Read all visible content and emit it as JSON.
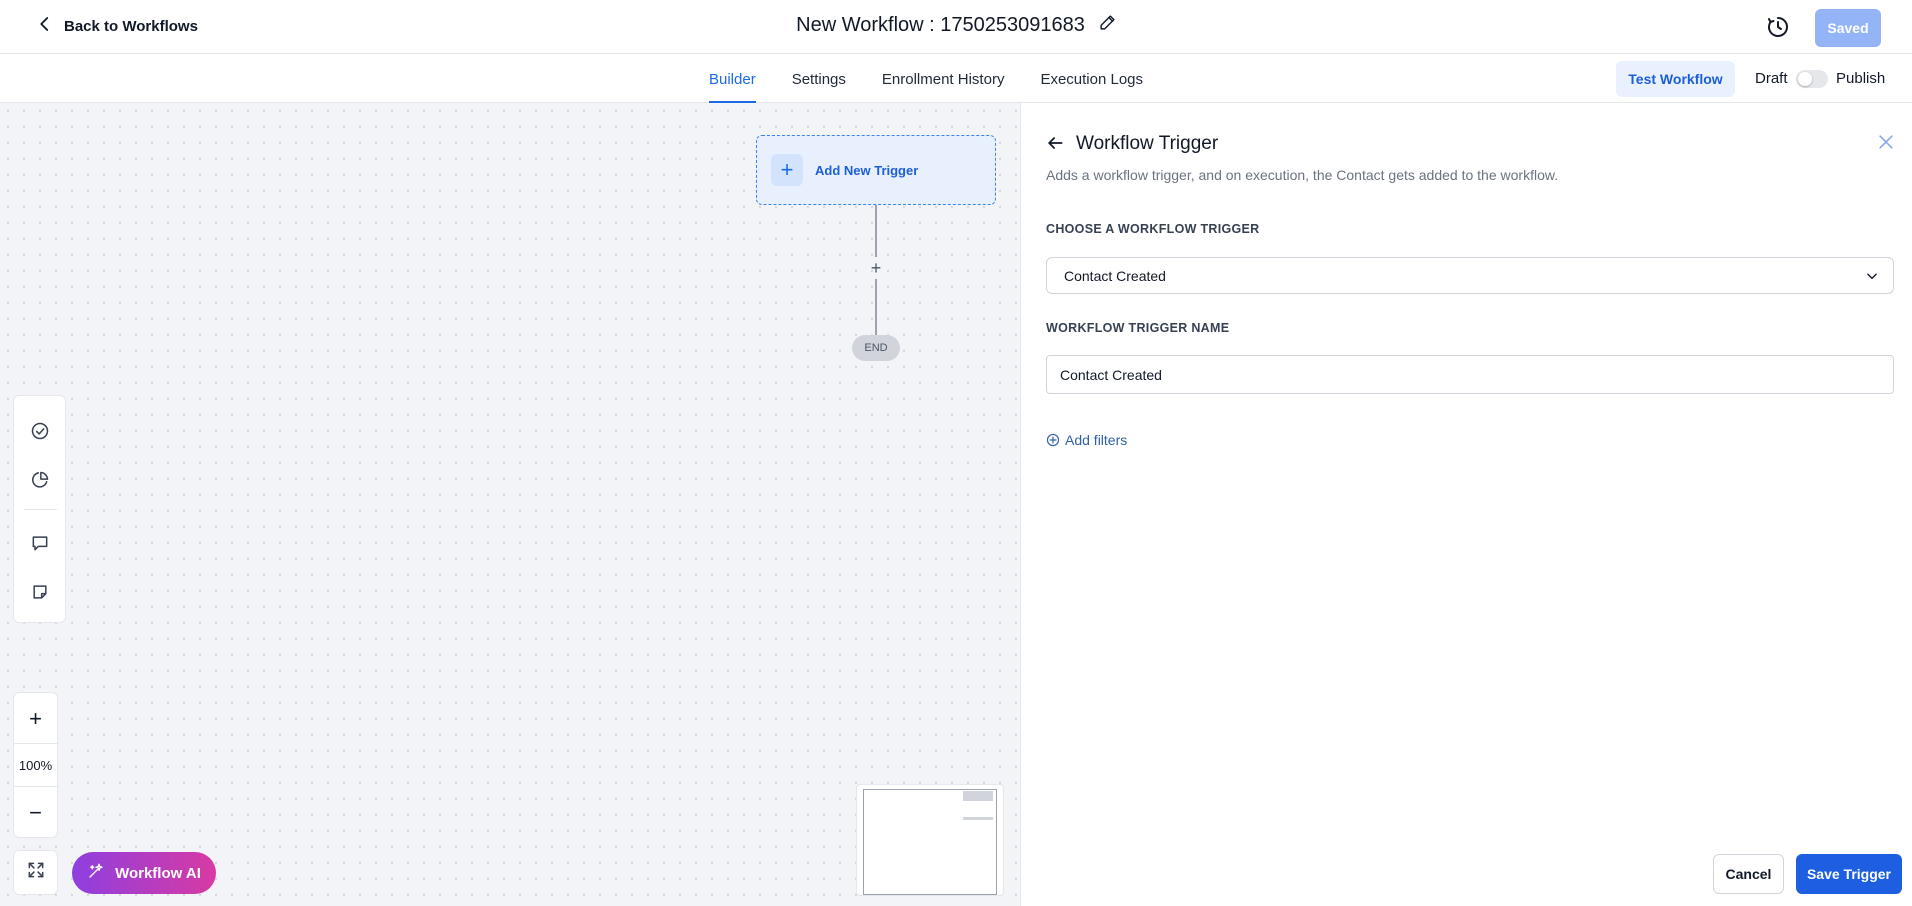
{
  "header": {
    "back_label": "Back to Workflows",
    "workflow_title": "New Workflow : 1750253091683",
    "saved_label": "Saved"
  },
  "tabs": [
    {
      "label": "Builder",
      "active": true
    },
    {
      "label": "Settings",
      "active": false
    },
    {
      "label": "Enrollment History",
      "active": false
    },
    {
      "label": "Execution Logs",
      "active": false
    }
  ],
  "actions": {
    "test_label": "Test Workflow",
    "draft_label": "Draft",
    "publish_label": "Publish",
    "published": false
  },
  "canvas": {
    "trigger_label": "Add New Trigger",
    "add_step_symbol": "+",
    "end_label": "END",
    "zoom_level": "100%",
    "zoom_in_symbol": "+",
    "zoom_out_symbol": "−",
    "ai_button_label": "Workflow AI"
  },
  "panel": {
    "title": "Workflow Trigger",
    "description": "Adds a workflow trigger, and on execution, the Contact gets added to the workflow.",
    "choose_label": "CHOOSE A WORKFLOW TRIGGER",
    "selected_trigger": "Contact Created",
    "name_label": "WORKFLOW TRIGGER NAME",
    "trigger_name_value": "Contact Created",
    "add_filters_label": "Add filters",
    "cancel_label": "Cancel",
    "save_label": "Save Trigger"
  },
  "icons": [
    "chevron-left-icon",
    "pencil-icon",
    "history-icon",
    "check-circle-icon",
    "pie-chart-icon",
    "comment-icon",
    "sticky-note-icon",
    "expand-icon",
    "sparkle-icon",
    "arrow-left-icon",
    "close-icon",
    "chevron-down-icon",
    "plus-circle-icon"
  ],
  "colors": {
    "accent": "#1d6ae5",
    "saved_button": "#93b4f7",
    "ai_gradient_start": "#8e3fe0",
    "ai_gradient_end": "#d83aa3"
  }
}
